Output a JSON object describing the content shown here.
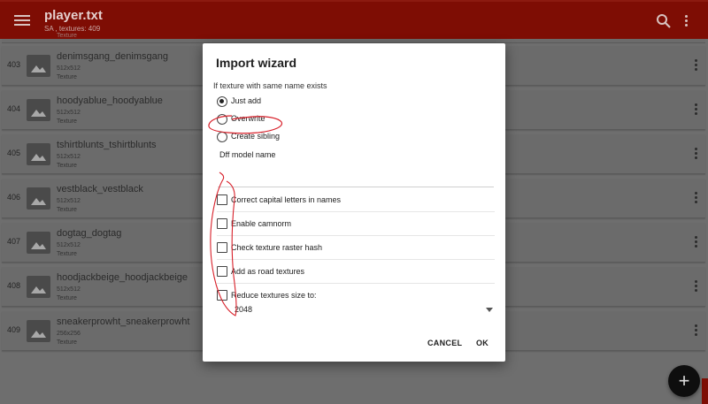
{
  "appbar": {
    "title": "player.txt",
    "subtitle": "SA , textures: 409",
    "icons": [
      "menu-icon",
      "search-icon",
      "more-vert-icon"
    ]
  },
  "list": {
    "partial_type": "Texture",
    "rows": [
      {
        "index": "403",
        "name": "denimsgang_denimsgang",
        "size": "512x512",
        "type": "Texture"
      },
      {
        "index": "404",
        "name": "hoodyablue_hoodyablue",
        "size": "512x512",
        "type": "Texture"
      },
      {
        "index": "405",
        "name": "tshirtblunts_tshirtblunts",
        "size": "512x512",
        "type": "Texture"
      },
      {
        "index": "406",
        "name": "vestblack_vestblack",
        "size": "512x512",
        "type": "Texture"
      },
      {
        "index": "407",
        "name": "dogtag_dogtag",
        "size": "512x512",
        "type": "Texture"
      },
      {
        "index": "408",
        "name": "hoodjackbeige_hoodjackbeige",
        "size": "512x512",
        "type": "Texture"
      },
      {
        "index": "409",
        "name": "sneakerprowht_sneakerprowht",
        "size": "256x256",
        "type": "Texture"
      }
    ]
  },
  "fab": {
    "label": "+"
  },
  "dialog": {
    "title": "Import wizard",
    "section_label": "If texture with same name exists",
    "radios": [
      {
        "label": "Just add",
        "selected": true
      },
      {
        "label": "Overwrite",
        "selected": false
      },
      {
        "label": "Create sibling",
        "selected": false
      }
    ],
    "dff_label": "Dff model name",
    "dff_value": "",
    "checkboxes": [
      {
        "label": "Correct capital letters in names",
        "checked": false
      },
      {
        "label": "Enable camnorm",
        "checked": false
      },
      {
        "label": "Check texture raster hash",
        "checked": false
      },
      {
        "label": "Add as road textures",
        "checked": false
      },
      {
        "label": "Reduce textures size to:",
        "checked": false
      }
    ],
    "reduce_size_value": "2048",
    "cancel_label": "CANCEL",
    "ok_label": "OK"
  },
  "colors": {
    "appbar": "#7e0d04",
    "list_background": "#6e6e6e",
    "dialog": "#ffffff",
    "annotation": "#d8202a",
    "fab": "#0e0e0e"
  }
}
